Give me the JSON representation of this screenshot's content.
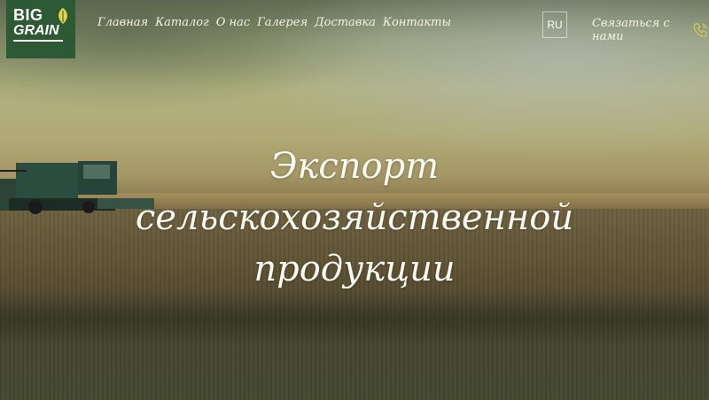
{
  "logo": {
    "line1": "BIG",
    "line2": "GRAIN"
  },
  "nav": {
    "items": [
      "Главная",
      "Каталог",
      "О нас",
      "Галерея",
      "Доставка",
      "Контакты"
    ]
  },
  "lang": {
    "current": "RU"
  },
  "contact": {
    "label": "Связаться с нами",
    "icon": "phone-icon"
  },
  "hero": {
    "line1": "Экспорт",
    "line2": "сельскохозяйственной",
    "line3": "продукции"
  },
  "colors": {
    "logo_bg": "#2d5a34",
    "leaf": "#e2d34a",
    "text": "#fafaf2"
  }
}
